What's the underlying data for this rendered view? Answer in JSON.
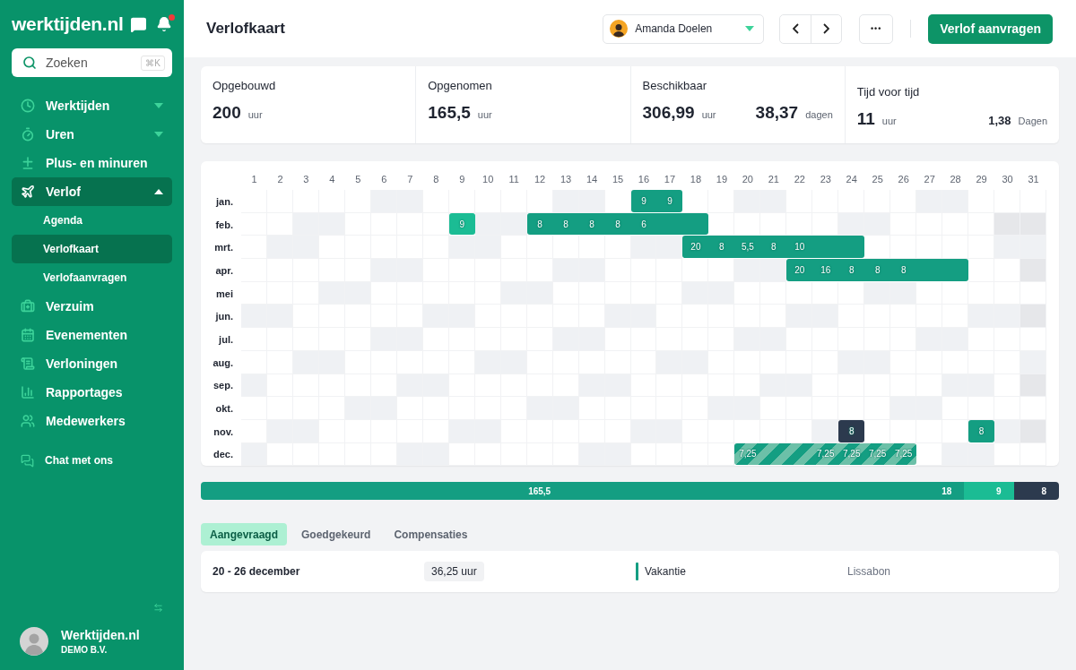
{
  "sidebar": {
    "logo": "werktijden.nl",
    "notifications": true,
    "search": {
      "placeholder": "Zoeken",
      "shortcut": "⌘K"
    },
    "items": [
      {
        "label": "Werktijden",
        "expanded": false,
        "selected": false
      },
      {
        "label": "Uren",
        "expanded": false,
        "selected": false
      },
      {
        "label": "Plus- en minuren",
        "selected": false
      },
      {
        "label": "Verlof",
        "expanded": true,
        "selected": true,
        "children": [
          {
            "label": "Agenda",
            "selected": false
          },
          {
            "label": "Verlofkaart",
            "selected": true
          },
          {
            "label": "Verlofaanvragen",
            "selected": false
          }
        ]
      },
      {
        "label": "Verzuim",
        "selected": false
      },
      {
        "label": "Evenementen",
        "selected": false
      },
      {
        "label": "Verloningen",
        "selected": false
      },
      {
        "label": "Rapportages",
        "selected": false
      },
      {
        "label": "Medewerkers",
        "selected": false
      }
    ],
    "chat": "Chat met ons",
    "account": {
      "name": "Werktijden.nl",
      "company": "DEMO B.V."
    }
  },
  "header": {
    "title": "Verlofkaart",
    "employee": "Amanda Doelen",
    "more": "•••",
    "primary_button": "Verlof aanvragen"
  },
  "stats": [
    {
      "label": "Opgebouwd",
      "value": "200",
      "unit": "uur"
    },
    {
      "label": "Opgenomen",
      "value": "165,5",
      "unit": "uur"
    },
    {
      "label": "Beschikbaar",
      "value": "306,99",
      "unit": "uur",
      "secondary": {
        "kind": "large",
        "value": "38,37",
        "unit": "dagen"
      }
    },
    {
      "label": "Tijd voor tijd",
      "value": "11",
      "unit": "uur",
      "secondary": {
        "kind": "small",
        "value": "1,38",
        "unit": "Dagen"
      }
    }
  ],
  "calendar": {
    "days": [
      "1",
      "2",
      "3",
      "4",
      "5",
      "6",
      "7",
      "8",
      "9",
      "10",
      "11",
      "12",
      "13",
      "14",
      "15",
      "16",
      "17",
      "18",
      "19",
      "20",
      "21",
      "22",
      "23",
      "24",
      "25",
      "26",
      "27",
      "28",
      "29",
      "30",
      "31"
    ],
    "months": [
      {
        "label": "jan.",
        "cells": [
          {
            "kind": "weekday"
          },
          {
            "kind": "weekday"
          },
          {
            "kind": "weekday"
          },
          {
            "kind": "weekday"
          },
          {
            "kind": "weekday"
          },
          {
            "kind": "weekend"
          },
          {
            "kind": "weekend"
          },
          {
            "kind": "weekday"
          },
          {
            "kind": "weekday"
          },
          {
            "kind": "weekday"
          },
          {
            "kind": "weekday"
          },
          {
            "kind": "weekday"
          },
          {
            "kind": "weekend"
          },
          {
            "kind": "weekend"
          },
          {
            "kind": "weekday"
          },
          {
            "kind": "approved",
            "hours": "9"
          },
          {
            "kind": "approved",
            "hours": "9"
          },
          {
            "kind": "weekday"
          },
          {
            "kind": "weekday"
          },
          {
            "kind": "weekend"
          },
          {
            "kind": "weekend"
          },
          {
            "kind": "weekday"
          },
          {
            "kind": "weekday"
          },
          {
            "kind": "weekday"
          },
          {
            "kind": "weekday"
          },
          {
            "kind": "weekday"
          },
          {
            "kind": "weekend"
          },
          {
            "kind": "weekend"
          },
          {
            "kind": "weekday"
          },
          {
            "kind": "weekday"
          },
          {
            "kind": "weekday"
          }
        ]
      },
      {
        "label": "feb.",
        "cells": [
          {
            "kind": "weekday"
          },
          {
            "kind": "weekday"
          },
          {
            "kind": "weekend"
          },
          {
            "kind": "weekend"
          },
          {
            "kind": "weekday"
          },
          {
            "kind": "weekday"
          },
          {
            "kind": "weekday"
          },
          {
            "kind": "weekday"
          },
          {
            "kind": "requested",
            "hours": "9"
          },
          {
            "kind": "weekend"
          },
          {
            "kind": "weekend"
          },
          {
            "kind": "approved",
            "hours": "8"
          },
          {
            "kind": "approved",
            "hours": "8"
          },
          {
            "kind": "approved",
            "hours": "8"
          },
          {
            "kind": "approved",
            "hours": "8"
          },
          {
            "kind": "approved",
            "hours": "6"
          },
          {
            "kind": "approved"
          },
          {
            "kind": "approved"
          },
          {
            "kind": "weekday"
          },
          {
            "kind": "weekday"
          },
          {
            "kind": "weekday"
          },
          {
            "kind": "weekday"
          },
          {
            "kind": "weekday"
          },
          {
            "kind": "weekend"
          },
          {
            "kind": "weekend"
          },
          {
            "kind": "weekday"
          },
          {
            "kind": "weekday"
          },
          {
            "kind": "weekday"
          },
          {
            "kind": "weekday"
          },
          {
            "kind": "missing"
          },
          {
            "kind": "missing"
          }
        ]
      },
      {
        "label": "mrt.",
        "cells": [
          {
            "kind": "weekday"
          },
          {
            "kind": "weekend"
          },
          {
            "kind": "weekend"
          },
          {
            "kind": "weekday"
          },
          {
            "kind": "weekday"
          },
          {
            "kind": "weekday"
          },
          {
            "kind": "weekday"
          },
          {
            "kind": "weekday"
          },
          {
            "kind": "weekend"
          },
          {
            "kind": "weekend"
          },
          {
            "kind": "weekday"
          },
          {
            "kind": "weekday"
          },
          {
            "kind": "weekday"
          },
          {
            "kind": "weekday"
          },
          {
            "kind": "weekday"
          },
          {
            "kind": "weekend"
          },
          {
            "kind": "weekend"
          },
          {
            "kind": "approved",
            "hours": "20"
          },
          {
            "kind": "approved",
            "hours": "8"
          },
          {
            "kind": "approved",
            "hours": "5,5"
          },
          {
            "kind": "approved",
            "hours": "8"
          },
          {
            "kind": "approved",
            "hours": "10"
          },
          {
            "kind": "approved"
          },
          {
            "kind": "approved"
          },
          {
            "kind": "weekday"
          },
          {
            "kind": "weekday"
          },
          {
            "kind": "weekday"
          },
          {
            "kind": "weekday"
          },
          {
            "kind": "weekday"
          },
          {
            "kind": "weekend"
          },
          {
            "kind": "weekend"
          }
        ]
      },
      {
        "label": "apr.",
        "cells": [
          {
            "kind": "weekday"
          },
          {
            "kind": "weekday"
          },
          {
            "kind": "weekday"
          },
          {
            "kind": "weekday"
          },
          {
            "kind": "weekday"
          },
          {
            "kind": "weekend"
          },
          {
            "kind": "weekend"
          },
          {
            "kind": "weekday"
          },
          {
            "kind": "weekday"
          },
          {
            "kind": "weekday"
          },
          {
            "kind": "weekday"
          },
          {
            "kind": "weekday"
          },
          {
            "kind": "weekend"
          },
          {
            "kind": "weekend"
          },
          {
            "kind": "weekday"
          },
          {
            "kind": "weekday"
          },
          {
            "kind": "weekday"
          },
          {
            "kind": "weekday"
          },
          {
            "kind": "weekday"
          },
          {
            "kind": "weekend"
          },
          {
            "kind": "weekend"
          },
          {
            "kind": "approved",
            "hours": "20"
          },
          {
            "kind": "approved",
            "hours": "16"
          },
          {
            "kind": "approved",
            "hours": "8"
          },
          {
            "kind": "approved",
            "hours": "8"
          },
          {
            "kind": "approved",
            "hours": "8"
          },
          {
            "kind": "approved"
          },
          {
            "kind": "approved"
          },
          {
            "kind": "weekday"
          },
          {
            "kind": "weekday"
          },
          {
            "kind": "missing"
          }
        ]
      },
      {
        "label": "mei",
        "cells": [
          {
            "kind": "weekday"
          },
          {
            "kind": "weekday"
          },
          {
            "kind": "weekday"
          },
          {
            "kind": "weekend"
          },
          {
            "kind": "weekend"
          },
          {
            "kind": "weekday"
          },
          {
            "kind": "weekday"
          },
          {
            "kind": "weekday"
          },
          {
            "kind": "weekday"
          },
          {
            "kind": "weekday"
          },
          {
            "kind": "weekend"
          },
          {
            "kind": "weekend"
          },
          {
            "kind": "weekday"
          },
          {
            "kind": "weekday"
          },
          {
            "kind": "weekday"
          },
          {
            "kind": "weekday"
          },
          {
            "kind": "weekday"
          },
          {
            "kind": "weekend"
          },
          {
            "kind": "weekend"
          },
          {
            "kind": "weekday"
          },
          {
            "kind": "weekday"
          },
          {
            "kind": "weekday"
          },
          {
            "kind": "weekday"
          },
          {
            "kind": "weekday"
          },
          {
            "kind": "weekend"
          },
          {
            "kind": "weekend"
          },
          {
            "kind": "weekday"
          },
          {
            "kind": "weekday"
          },
          {
            "kind": "weekday"
          },
          {
            "kind": "weekday"
          },
          {
            "kind": "weekday"
          }
        ]
      },
      {
        "label": "jun.",
        "cells": [
          {
            "kind": "weekend"
          },
          {
            "kind": "weekend"
          },
          {
            "kind": "weekday"
          },
          {
            "kind": "weekday"
          },
          {
            "kind": "weekday"
          },
          {
            "kind": "weekday"
          },
          {
            "kind": "weekday"
          },
          {
            "kind": "weekend"
          },
          {
            "kind": "weekend"
          },
          {
            "kind": "weekday"
          },
          {
            "kind": "weekday"
          },
          {
            "kind": "weekday"
          },
          {
            "kind": "weekday"
          },
          {
            "kind": "weekday"
          },
          {
            "kind": "weekend"
          },
          {
            "kind": "weekend"
          },
          {
            "kind": "weekday"
          },
          {
            "kind": "weekday"
          },
          {
            "kind": "weekday"
          },
          {
            "kind": "weekday"
          },
          {
            "kind": "weekday"
          },
          {
            "kind": "weekend"
          },
          {
            "kind": "weekend"
          },
          {
            "kind": "weekday"
          },
          {
            "kind": "weekday"
          },
          {
            "kind": "weekday"
          },
          {
            "kind": "weekday"
          },
          {
            "kind": "weekday"
          },
          {
            "kind": "weekend"
          },
          {
            "kind": "weekend"
          },
          {
            "kind": "missing"
          }
        ]
      },
      {
        "label": "jul.",
        "cells": [
          {
            "kind": "weekday"
          },
          {
            "kind": "weekday"
          },
          {
            "kind": "weekday"
          },
          {
            "kind": "weekday"
          },
          {
            "kind": "weekday"
          },
          {
            "kind": "weekend"
          },
          {
            "kind": "weekend"
          },
          {
            "kind": "weekday"
          },
          {
            "kind": "weekday"
          },
          {
            "kind": "weekday"
          },
          {
            "kind": "weekday"
          },
          {
            "kind": "weekday"
          },
          {
            "kind": "weekend"
          },
          {
            "kind": "weekend"
          },
          {
            "kind": "weekday"
          },
          {
            "kind": "weekday"
          },
          {
            "kind": "weekday"
          },
          {
            "kind": "weekday"
          },
          {
            "kind": "weekday"
          },
          {
            "kind": "weekend"
          },
          {
            "kind": "weekend"
          },
          {
            "kind": "weekday"
          },
          {
            "kind": "weekday"
          },
          {
            "kind": "weekday"
          },
          {
            "kind": "weekday"
          },
          {
            "kind": "weekday"
          },
          {
            "kind": "weekend"
          },
          {
            "kind": "weekend"
          },
          {
            "kind": "weekday"
          },
          {
            "kind": "weekday"
          },
          {
            "kind": "weekday"
          }
        ]
      },
      {
        "label": "aug.",
        "cells": [
          {
            "kind": "weekday"
          },
          {
            "kind": "weekday"
          },
          {
            "kind": "weekend"
          },
          {
            "kind": "weekend"
          },
          {
            "kind": "weekday"
          },
          {
            "kind": "weekday"
          },
          {
            "kind": "weekday"
          },
          {
            "kind": "weekday"
          },
          {
            "kind": "weekday"
          },
          {
            "kind": "weekend"
          },
          {
            "kind": "weekend"
          },
          {
            "kind": "weekday"
          },
          {
            "kind": "weekday"
          },
          {
            "kind": "weekday"
          },
          {
            "kind": "weekday"
          },
          {
            "kind": "weekday"
          },
          {
            "kind": "weekend"
          },
          {
            "kind": "weekend"
          },
          {
            "kind": "weekday"
          },
          {
            "kind": "weekday"
          },
          {
            "kind": "weekday"
          },
          {
            "kind": "weekday"
          },
          {
            "kind": "weekday"
          },
          {
            "kind": "weekend"
          },
          {
            "kind": "weekend"
          },
          {
            "kind": "weekday"
          },
          {
            "kind": "weekday"
          },
          {
            "kind": "weekday"
          },
          {
            "kind": "weekday"
          },
          {
            "kind": "weekday"
          },
          {
            "kind": "weekend"
          }
        ]
      },
      {
        "label": "sep.",
        "cells": [
          {
            "kind": "weekend"
          },
          {
            "kind": "weekday"
          },
          {
            "kind": "weekday"
          },
          {
            "kind": "weekday"
          },
          {
            "kind": "weekday"
          },
          {
            "kind": "weekday"
          },
          {
            "kind": "weekend"
          },
          {
            "kind": "weekend"
          },
          {
            "kind": "weekday"
          },
          {
            "kind": "weekday"
          },
          {
            "kind": "weekday"
          },
          {
            "kind": "weekday"
          },
          {
            "kind": "weekday"
          },
          {
            "kind": "weekend"
          },
          {
            "kind": "weekend"
          },
          {
            "kind": "weekday"
          },
          {
            "kind": "weekday"
          },
          {
            "kind": "weekday"
          },
          {
            "kind": "weekday"
          },
          {
            "kind": "weekday"
          },
          {
            "kind": "weekend"
          },
          {
            "kind": "weekend"
          },
          {
            "kind": "weekday"
          },
          {
            "kind": "weekday"
          },
          {
            "kind": "weekday"
          },
          {
            "kind": "weekday"
          },
          {
            "kind": "weekday"
          },
          {
            "kind": "weekend"
          },
          {
            "kind": "weekend"
          },
          {
            "kind": "weekday"
          },
          {
            "kind": "missing"
          }
        ]
      },
      {
        "label": "okt.",
        "cells": [
          {
            "kind": "weekday"
          },
          {
            "kind": "weekday"
          },
          {
            "kind": "weekday"
          },
          {
            "kind": "weekday"
          },
          {
            "kind": "weekend"
          },
          {
            "kind": "weekend"
          },
          {
            "kind": "weekday"
          },
          {
            "kind": "weekday"
          },
          {
            "kind": "weekday"
          },
          {
            "kind": "weekday"
          },
          {
            "kind": "weekday"
          },
          {
            "kind": "weekend"
          },
          {
            "kind": "weekend"
          },
          {
            "kind": "weekday"
          },
          {
            "kind": "weekday"
          },
          {
            "kind": "weekday"
          },
          {
            "kind": "weekday"
          },
          {
            "kind": "weekday"
          },
          {
            "kind": "weekend"
          },
          {
            "kind": "weekend"
          },
          {
            "kind": "weekday"
          },
          {
            "kind": "weekday"
          },
          {
            "kind": "weekday"
          },
          {
            "kind": "weekday"
          },
          {
            "kind": "weekday"
          },
          {
            "kind": "weekend"
          },
          {
            "kind": "weekend"
          },
          {
            "kind": "weekday"
          },
          {
            "kind": "weekday"
          },
          {
            "kind": "weekday"
          },
          {
            "kind": "weekday"
          }
        ]
      },
      {
        "label": "nov.",
        "cells": [
          {
            "kind": "weekday"
          },
          {
            "kind": "weekend"
          },
          {
            "kind": "weekend"
          },
          {
            "kind": "weekday"
          },
          {
            "kind": "weekday"
          },
          {
            "kind": "weekday"
          },
          {
            "kind": "weekday"
          },
          {
            "kind": "weekday"
          },
          {
            "kind": "weekend"
          },
          {
            "kind": "weekend"
          },
          {
            "kind": "weekday"
          },
          {
            "kind": "weekday"
          },
          {
            "kind": "weekday"
          },
          {
            "kind": "weekday"
          },
          {
            "kind": "weekday"
          },
          {
            "kind": "weekend"
          },
          {
            "kind": "weekend"
          },
          {
            "kind": "weekday"
          },
          {
            "kind": "weekday"
          },
          {
            "kind": "weekday"
          },
          {
            "kind": "weekday"
          },
          {
            "kind": "weekday"
          },
          {
            "kind": "weekend"
          },
          {
            "kind": "other",
            "hours": "8"
          },
          {
            "kind": "weekday"
          },
          {
            "kind": "weekday"
          },
          {
            "kind": "weekday"
          },
          {
            "kind": "weekday"
          },
          {
            "kind": "approved",
            "hours": "8"
          },
          {
            "kind": "weekend"
          },
          {
            "kind": "missing"
          }
        ]
      },
      {
        "label": "dec.",
        "cells": [
          {
            "kind": "weekend"
          },
          {
            "kind": "weekday"
          },
          {
            "kind": "weekday"
          },
          {
            "kind": "weekday"
          },
          {
            "kind": "weekday"
          },
          {
            "kind": "weekday"
          },
          {
            "kind": "weekend"
          },
          {
            "kind": "weekend"
          },
          {
            "kind": "weekday"
          },
          {
            "kind": "weekday"
          },
          {
            "kind": "weekday"
          },
          {
            "kind": "weekday"
          },
          {
            "kind": "weekday"
          },
          {
            "kind": "weekend"
          },
          {
            "kind": "weekend"
          },
          {
            "kind": "weekday"
          },
          {
            "kind": "weekday"
          },
          {
            "kind": "weekday"
          },
          {
            "kind": "weekday"
          },
          {
            "kind": "pending",
            "hours": "7,25"
          },
          {
            "kind": "pending"
          },
          {
            "kind": "pending"
          },
          {
            "kind": "pending",
            "hours": "7,25"
          },
          {
            "kind": "pending",
            "hours": "7,25"
          },
          {
            "kind": "pending",
            "hours": "7,25"
          },
          {
            "kind": "pending",
            "hours": "7,25"
          },
          {
            "kind": "weekday"
          },
          {
            "kind": "weekend"
          },
          {
            "kind": "weekend"
          },
          {
            "kind": "weekday"
          },
          {
            "kind": "weekday"
          }
        ]
      }
    ]
  },
  "summary": [
    {
      "kind": "approved",
      "label": "165,5"
    },
    {
      "kind": "approved",
      "label": "18"
    },
    {
      "kind": "requested",
      "label": "9"
    },
    {
      "kind": "other",
      "label": "8"
    }
  ],
  "tabs": [
    {
      "label": "Aangevraagd",
      "selected": true
    },
    {
      "label": "Goedgekeurd",
      "selected": false
    },
    {
      "label": "Compensaties",
      "selected": false
    }
  ],
  "requests": [
    {
      "period": "20 - 26 december",
      "hours": "36,25 uur",
      "type": "Vakantie",
      "color": "#149e82",
      "note": "Lissabon"
    }
  ]
}
